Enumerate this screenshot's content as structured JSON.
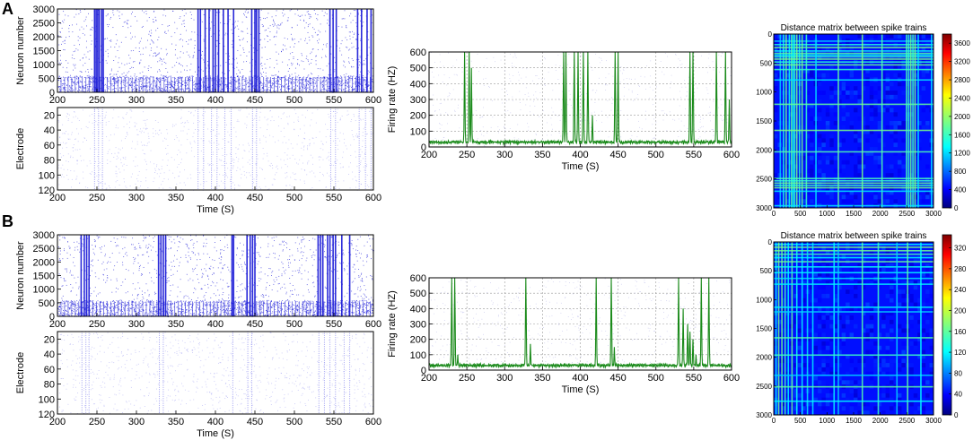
{
  "chart_data": [
    {
      "panel": "A",
      "type": "scatter",
      "subtype": "raster",
      "ylabel": "Neuron number",
      "xlim": [
        200,
        600
      ],
      "ylim": [
        0,
        3000
      ],
      "yticks": [
        0,
        500,
        1000,
        1500,
        2000,
        2500,
        3000
      ],
      "xticks": [
        200,
        250,
        300,
        350,
        400,
        450,
        500,
        550,
        600
      ],
      "color": "#1f1fd8",
      "burst_times": [
        247,
        249,
        251,
        253,
        256,
        258,
        378,
        381,
        387,
        392,
        397,
        400,
        404,
        410,
        416,
        423,
        446,
        450,
        452,
        455,
        545,
        549,
        553,
        580,
        585,
        592,
        597
      ]
    },
    {
      "panel": "A",
      "type": "scatter",
      "subtype": "raster",
      "xlabel": "Time (S)",
      "ylabel": "Electrode",
      "xlim": [
        200,
        600
      ],
      "ylim": [
        120,
        10
      ],
      "yticks": [
        20,
        40,
        60,
        80,
        100,
        120
      ],
      "xticks": [
        200,
        250,
        300,
        350,
        400,
        450,
        500,
        550,
        600
      ],
      "color": "#8080ee",
      "burst_times": [
        247,
        252,
        257,
        378,
        385,
        395,
        402,
        412,
        420,
        447,
        452,
        546,
        552,
        582,
        590,
        597
      ]
    },
    {
      "panel": "A",
      "type": "line",
      "xlabel": "Time (S)",
      "ylabel": "Firing rate (HZ)",
      "xlim": [
        200,
        600
      ],
      "ylim": [
        0,
        600
      ],
      "yticks": [
        0,
        100,
        200,
        300,
        400,
        500,
        600
      ],
      "xticks": [
        200,
        250,
        300,
        350,
        400,
        450,
        500,
        550,
        600
      ],
      "grid": true,
      "color": "#1a8a1a",
      "baseline": 30,
      "peaks": [
        [
          247,
          600
        ],
        [
          253,
          600
        ],
        [
          256,
          500
        ],
        [
          378,
          600
        ],
        [
          381,
          600
        ],
        [
          392,
          600
        ],
        [
          397,
          600
        ],
        [
          404,
          600
        ],
        [
          410,
          600
        ],
        [
          416,
          200
        ],
        [
          446,
          600
        ],
        [
          450,
          600
        ],
        [
          545,
          600
        ],
        [
          549,
          600
        ],
        [
          580,
          600
        ],
        [
          592,
          600
        ],
        [
          597,
          300
        ]
      ]
    },
    {
      "panel": "A",
      "type": "heatmap",
      "title": "Distance matrix between spike trains",
      "xlim": [
        0,
        3000
      ],
      "ylim": [
        3000,
        0
      ],
      "xticks": [
        0,
        500,
        1000,
        1500,
        2000,
        2500,
        3000
      ],
      "yticks": [
        0,
        500,
        1000,
        1500,
        2000,
        2500,
        3000
      ],
      "colorbar": [
        0,
        400,
        800,
        1200,
        1600,
        2000,
        2400,
        2800,
        3200,
        3600
      ],
      "colorbar_max": 3800,
      "band_positions": [
        110,
        170,
        220,
        280,
        320,
        350,
        380,
        420,
        470,
        520,
        600,
        780,
        1200,
        1650,
        2020,
        2480,
        2520,
        2560,
        2600,
        2640,
        2700,
        2950
      ]
    },
    {
      "panel": "B",
      "type": "scatter",
      "subtype": "raster",
      "ylabel": "Neuron number",
      "xlim": [
        200,
        600
      ],
      "ylim": [
        0,
        3000
      ],
      "yticks": [
        0,
        500,
        1000,
        1500,
        2000,
        2500,
        3000
      ],
      "xticks": [
        200,
        250,
        300,
        350,
        400,
        450,
        500,
        550,
        600
      ],
      "color": "#1f1fd8",
      "burst_times": [
        230,
        234,
        237,
        240,
        328,
        331,
        334,
        337,
        421,
        423,
        440,
        444,
        447,
        450,
        530,
        533,
        536,
        542,
        545,
        549,
        552,
        560,
        570
      ]
    },
    {
      "panel": "B",
      "type": "scatter",
      "subtype": "raster",
      "xlabel": "Time (S)",
      "ylabel": "Electrode",
      "xlim": [
        200,
        600
      ],
      "ylim": [
        120,
        10
      ],
      "yticks": [
        20,
        40,
        60,
        80,
        100,
        120
      ],
      "xticks": [
        200,
        250,
        300,
        350,
        400,
        450,
        500,
        550,
        600
      ],
      "color": "#8080ee",
      "burst_times": [
        231,
        236,
        240,
        329,
        334,
        422,
        441,
        446,
        531,
        538,
        545,
        552,
        563,
        570
      ]
    },
    {
      "panel": "B",
      "type": "line",
      "xlabel": "Time (S)",
      "ylabel": "Firing rate (HZ)",
      "xlim": [
        200,
        600
      ],
      "ylim": [
        0,
        600
      ],
      "yticks": [
        0,
        100,
        200,
        300,
        400,
        500,
        600
      ],
      "xticks": [
        200,
        250,
        300,
        350,
        400,
        450,
        500,
        550,
        600
      ],
      "grid": true,
      "color": "#1a8a1a",
      "baseline": 30,
      "peaks": [
        [
          230,
          600
        ],
        [
          234,
          600
        ],
        [
          238,
          100
        ],
        [
          328,
          600
        ],
        [
          334,
          170
        ],
        [
          421,
          600
        ],
        [
          441,
          600
        ],
        [
          445,
          150
        ],
        [
          530,
          600
        ],
        [
          536,
          400
        ],
        [
          542,
          300
        ],
        [
          545,
          250
        ],
        [
          549,
          200
        ],
        [
          553,
          100
        ],
        [
          560,
          600
        ],
        [
          570,
          600
        ]
      ]
    },
    {
      "panel": "B",
      "type": "heatmap",
      "title": "Distance matrix between spike trains",
      "xlim": [
        0,
        3000
      ],
      "ylim": [
        3000,
        0
      ],
      "xticks": [
        0,
        500,
        1000,
        1500,
        2000,
        2500,
        3000
      ],
      "yticks": [
        0,
        500,
        1000,
        1500,
        2000,
        2500,
        3000
      ],
      "colorbar": [
        0,
        40,
        80,
        120,
        160,
        200,
        240,
        280,
        320
      ],
      "colorbar_max": 345,
      "band_positions": [
        30,
        80,
        140,
        200,
        260,
        330,
        420,
        520,
        620,
        720,
        1120,
        1200,
        1650,
        1950,
        2300,
        2500,
        2750
      ]
    }
  ],
  "labels": {
    "panel_a": "A",
    "panel_b": "B"
  }
}
